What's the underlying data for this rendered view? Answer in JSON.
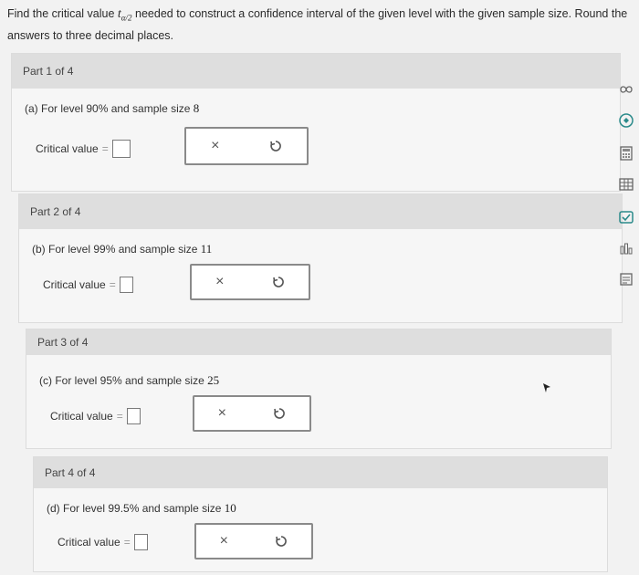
{
  "question": {
    "prefix": "Find the critical value",
    "t_symbol": "t",
    "t_subscript": "α/2",
    "suffix": "needed to construct a confidence interval of the given level with the given sample size. Round the answers to three decimal places."
  },
  "parts": [
    {
      "header": "Part 1 of 4",
      "prompt": "(a) For level 90% and sample size",
      "n": "8",
      "cv_label": "Critical value",
      "eq": "="
    },
    {
      "header": "Part 2 of 4",
      "prompt": "(b) For level 99% and sample size",
      "n": "11",
      "cv_label": "Critical value",
      "eq": "="
    },
    {
      "header": "Part 3 of 4",
      "prompt": "(c) For level 95% and sample size",
      "n": "25",
      "cv_label": "Critical value",
      "eq": "="
    },
    {
      "header": "Part 4 of 4",
      "prompt": "(d) For level 99.5% and sample size",
      "n": "10",
      "cv_label": "Critical value",
      "eq": "="
    }
  ],
  "controls": {
    "clear_symbol": "×"
  },
  "sidebar_icons": [
    "infinity-icon",
    "rotate-icon",
    "calculator-icon",
    "table-icon",
    "checkmark-box-icon",
    "data-icon",
    "notes-icon"
  ],
  "colors": {
    "accent_teal": "#2a8a8a",
    "header_bg": "#dedede"
  }
}
